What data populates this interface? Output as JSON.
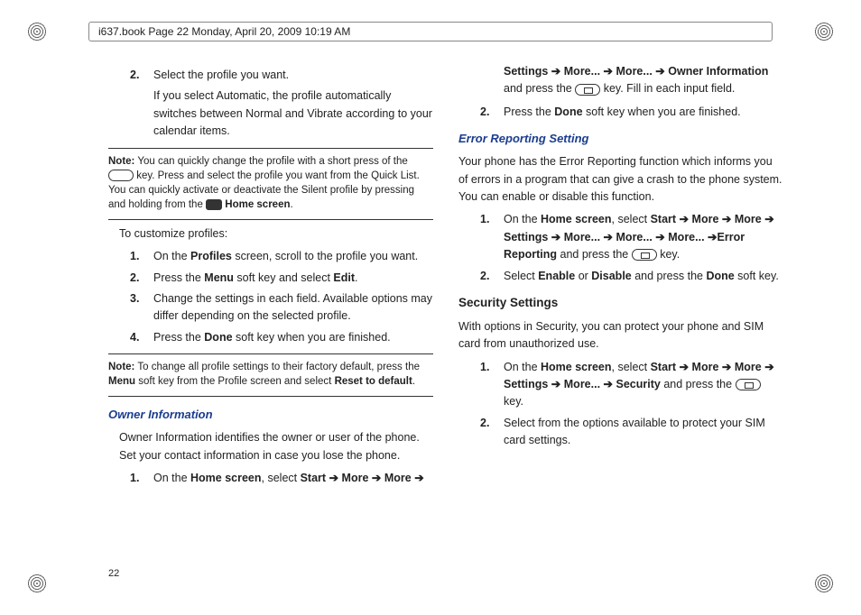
{
  "crop": {
    "header": "i637.book  Page 22  Monday, April 20, 2009  10:19 AM"
  },
  "page_number": "22",
  "left": {
    "step2": {
      "n": "2.",
      "t": "Select the profile you want."
    },
    "step2_sub": "If you select Automatic, the profile automatically switches between Normal and Vibrate according to your calendar items.",
    "note1_lbl": "Note:",
    "note1_a": "You can quickly change the profile with a short press of the",
    "note1_b": "key. Press and select the profile you want from the Quick List. You can quickly activate or deactivate the Silent profile by pressing and holding from the",
    "note1_c": "Home screen",
    "note1_d": ".",
    "custom_intro": "To customize profiles:",
    "c1": {
      "n": "1.",
      "a": "On the ",
      "b": "Profiles",
      "c": " screen, scroll to the profile you want."
    },
    "c2": {
      "n": "2.",
      "a": "Press the ",
      "b": "Menu",
      "c": " soft key and select ",
      "d": "Edit",
      "e": "."
    },
    "c3": {
      "n": "3.",
      "t": "Change the settings in each field. Available options may differ depending on the selected profile."
    },
    "c4": {
      "n": "4.",
      "a": "Press the ",
      "b": "Done",
      "c": " soft key when you are finished."
    },
    "note2_lbl": "Note:",
    "note2_a": "To change all profile settings to their factory default, press the ",
    "note2_b": "Menu",
    "note2_c": " soft key from the Profile screen and select ",
    "note2_d": "Reset to default",
    "note2_e": ".",
    "owner_h": "Owner Information",
    "owner_p": "Owner Information identifies the owner or user of the phone. Set your contact information in case you lose the phone.",
    "o1": {
      "n": "1.",
      "a": "On the ",
      "b": "Home screen",
      "c": ", select ",
      "d": "Start",
      "e": "More",
      "f": "More"
    }
  },
  "right": {
    "o1b": {
      "a": "Settings",
      "b": "More...",
      "c": "More...",
      "d": "Owner Information",
      "e": " and press the ",
      "f": " key. Fill in each input field."
    },
    "o2": {
      "n": "2.",
      "a": "Press the ",
      "b": "Done",
      "c": " soft key when you are finished."
    },
    "err_h": "Error Reporting Setting",
    "err_p": "Your phone has the Error Reporting function which informs you of errors in a program that can give a crash to the phone system. You can enable or disable this function.",
    "e1": {
      "n": "1.",
      "a": "On the ",
      "b": "Home screen",
      "c": ", select ",
      "d": "Start",
      "e": "More",
      "f": "More",
      "g": "Settings",
      "h": "More...",
      "i": "More...",
      "j": "More...",
      "k": "Error Reporting",
      "l": " and press the ",
      "m": " key."
    },
    "e2": {
      "n": "2.",
      "a": "Select ",
      "b": "Enable",
      "c": " or ",
      "d": "Disable",
      "e": " and press the ",
      "f": "Done",
      "g": " soft key."
    },
    "sec_h": "Security Settings",
    "sec_p": "With options in Security, you can protect your phone and SIM card from unauthorized use.",
    "s1": {
      "n": "1.",
      "a": "On the ",
      "b": "Home screen",
      "c": ", select ",
      "d": "Start",
      "e": "More",
      "f": "More",
      "g": "Settings",
      "h": "More...",
      "i": "Security",
      "j": " and press the ",
      "k": " key."
    },
    "s2": {
      "n": "2.",
      "t": "Select from the options available to protect your SIM card settings."
    }
  },
  "arrow": "➔"
}
